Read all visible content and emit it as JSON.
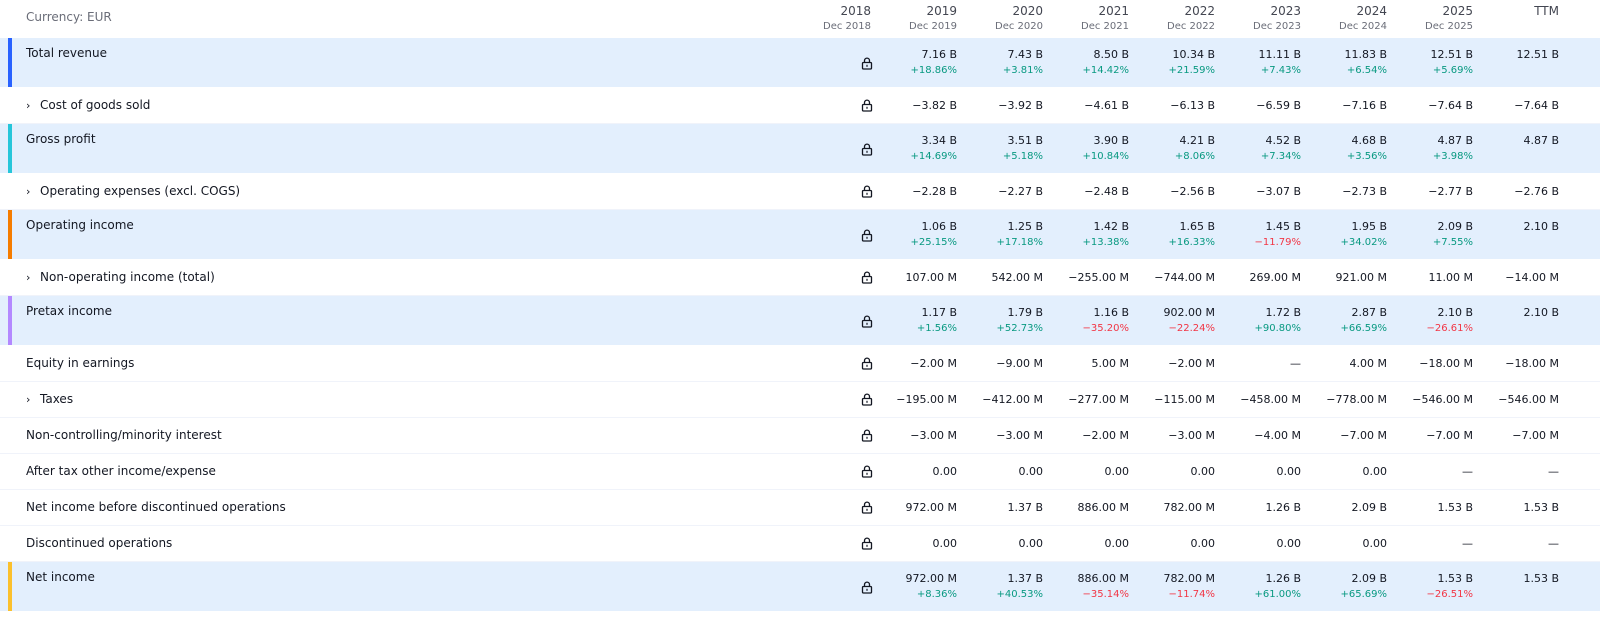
{
  "currency_label": "Currency: EUR",
  "columns": [
    {
      "year": "2018",
      "date": "Dec 2018"
    },
    {
      "year": "2019",
      "date": "Dec 2019"
    },
    {
      "year": "2020",
      "date": "Dec 2020"
    },
    {
      "year": "2021",
      "date": "Dec 2021"
    },
    {
      "year": "2022",
      "date": "Dec 2022"
    },
    {
      "year": "2023",
      "date": "Dec 2023"
    },
    {
      "year": "2024",
      "date": "Dec 2024"
    },
    {
      "year": "2025",
      "date": "Dec 2025"
    },
    {
      "year": "TTM",
      "date": ""
    }
  ],
  "rows": [
    {
      "label": "Total revenue",
      "highlight": true,
      "expandable": false,
      "accent": "#2962ff",
      "values": [
        "7.16 B",
        "7.43 B",
        "8.50 B",
        "10.34 B",
        "11.11 B",
        "11.83 B",
        "12.51 B",
        "12.51 B"
      ],
      "changes": [
        "+18.86%",
        "+3.81%",
        "+14.42%",
        "+21.59%",
        "+7.43%",
        "+6.54%",
        "+5.69%",
        ""
      ]
    },
    {
      "label": "Cost of goods sold",
      "highlight": false,
      "expandable": true,
      "accent": "",
      "values": [
        "−3.82 B",
        "−3.92 B",
        "−4.61 B",
        "−6.13 B",
        "−6.59 B",
        "−7.16 B",
        "−7.64 B",
        "−7.64 B"
      ],
      "changes": []
    },
    {
      "label": "Gross profit",
      "highlight": true,
      "expandable": false,
      "accent": "#26c6da",
      "values": [
        "3.34 B",
        "3.51 B",
        "3.90 B",
        "4.21 B",
        "4.52 B",
        "4.68 B",
        "4.87 B",
        "4.87 B"
      ],
      "changes": [
        "+14.69%",
        "+5.18%",
        "+10.84%",
        "+8.06%",
        "+7.34%",
        "+3.56%",
        "+3.98%",
        ""
      ]
    },
    {
      "label": "Operating expenses (excl. COGS)",
      "highlight": false,
      "expandable": true,
      "accent": "",
      "values": [
        "−2.28 B",
        "−2.27 B",
        "−2.48 B",
        "−2.56 B",
        "−3.07 B",
        "−2.73 B",
        "−2.77 B",
        "−2.76 B"
      ],
      "changes": []
    },
    {
      "label": "Operating income",
      "highlight": true,
      "expandable": false,
      "accent": "#f57c00",
      "values": [
        "1.06 B",
        "1.25 B",
        "1.42 B",
        "1.65 B",
        "1.45 B",
        "1.95 B",
        "2.09 B",
        "2.10 B"
      ],
      "changes": [
        "+25.15%",
        "+17.18%",
        "+13.38%",
        "+16.33%",
        "−11.79%",
        "+34.02%",
        "+7.55%",
        ""
      ]
    },
    {
      "label": "Non-operating income (total)",
      "highlight": false,
      "expandable": true,
      "accent": "",
      "values": [
        "107.00 M",
        "542.00 M",
        "−255.00 M",
        "−744.00 M",
        "269.00 M",
        "921.00 M",
        "11.00 M",
        "−14.00 M"
      ],
      "changes": []
    },
    {
      "label": "Pretax income",
      "highlight": true,
      "expandable": false,
      "accent": "#b388ff",
      "values": [
        "1.17 B",
        "1.79 B",
        "1.16 B",
        "902.00 M",
        "1.72 B",
        "2.87 B",
        "2.10 B",
        "2.10 B"
      ],
      "changes": [
        "+1.56%",
        "+52.73%",
        "−35.20%",
        "−22.24%",
        "+90.80%",
        "+66.59%",
        "−26.61%",
        ""
      ]
    },
    {
      "label": "Equity in earnings",
      "highlight": false,
      "expandable": false,
      "accent": "",
      "values": [
        "−2.00 M",
        "−9.00 M",
        "5.00 M",
        "−2.00 M",
        "—",
        "4.00 M",
        "−18.00 M",
        "−18.00 M"
      ],
      "changes": []
    },
    {
      "label": "Taxes",
      "highlight": false,
      "expandable": true,
      "accent": "",
      "values": [
        "−195.00 M",
        "−412.00 M",
        "−277.00 M",
        "−115.00 M",
        "−458.00 M",
        "−778.00 M",
        "−546.00 M",
        "−546.00 M"
      ],
      "changes": []
    },
    {
      "label": "Non-controlling/minority interest",
      "highlight": false,
      "expandable": false,
      "accent": "",
      "values": [
        "−3.00 M",
        "−3.00 M",
        "−2.00 M",
        "−3.00 M",
        "−4.00 M",
        "−7.00 M",
        "−7.00 M",
        "−7.00 M"
      ],
      "changes": []
    },
    {
      "label": "After tax other income/expense",
      "highlight": false,
      "expandable": false,
      "accent": "",
      "values": [
        "0.00",
        "0.00",
        "0.00",
        "0.00",
        "0.00",
        "0.00",
        "—",
        "—"
      ],
      "changes": []
    },
    {
      "label": "Net income before discontinued operations",
      "highlight": false,
      "expandable": false,
      "accent": "",
      "values": [
        "972.00 M",
        "1.37 B",
        "886.00 M",
        "782.00 M",
        "1.26 B",
        "2.09 B",
        "1.53 B",
        "1.53 B"
      ],
      "changes": []
    },
    {
      "label": "Discontinued operations",
      "highlight": false,
      "expandable": false,
      "accent": "",
      "values": [
        "0.00",
        "0.00",
        "0.00",
        "0.00",
        "0.00",
        "0.00",
        "—",
        "—"
      ],
      "changes": []
    },
    {
      "label": "Net income",
      "highlight": true,
      "expandable": false,
      "accent": "#fbc02d",
      "values": [
        "972.00 M",
        "1.37 B",
        "886.00 M",
        "782.00 M",
        "1.26 B",
        "2.09 B",
        "1.53 B",
        "1.53 B"
      ],
      "changes": [
        "+8.36%",
        "+40.53%",
        "−35.14%",
        "−11.74%",
        "+61.00%",
        "+65.69%",
        "−26.51%",
        ""
      ]
    }
  ]
}
